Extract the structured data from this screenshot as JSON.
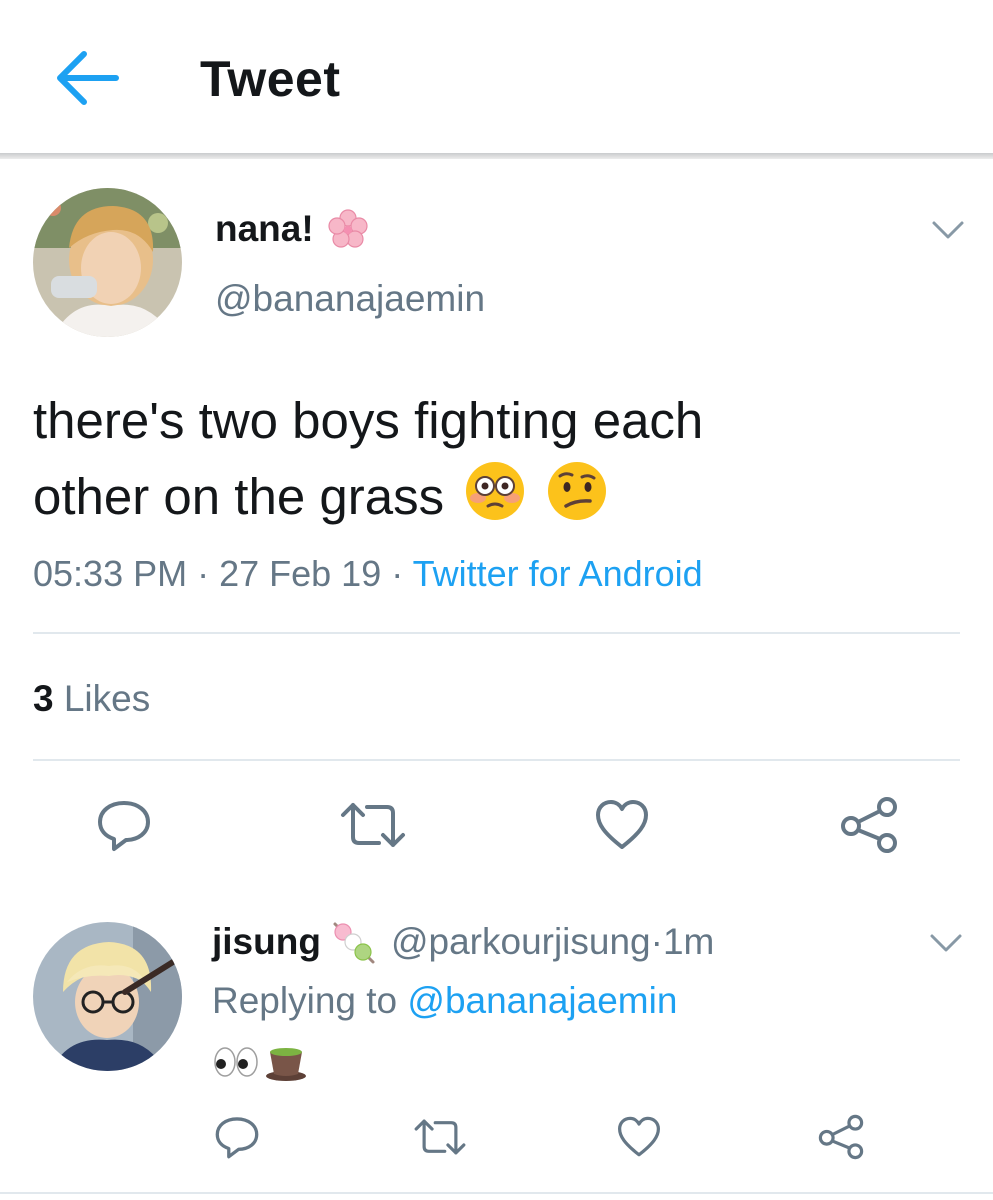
{
  "header": {
    "title": "Tweet"
  },
  "tweet": {
    "author_name": "nana!",
    "author_handle": "@bananajaemin",
    "text_line1": "there's two boys fighting each",
    "text_line2": "other on the grass",
    "time": "05:33 PM",
    "sep1": " · ",
    "date": "27 Feb 19",
    "sep2": " · ",
    "source": "Twitter for Android",
    "likes_count": "3",
    "likes_label": "Likes"
  },
  "reply": {
    "author_name": "jisung",
    "author_handle": "@parkourjisung",
    "dot": " · ",
    "time": "1m",
    "replying_prefix": "Replying to ",
    "replying_to": "@bananajaemin"
  },
  "icons": {
    "back": "arrow-left-icon",
    "caret": "chevron-down-icon",
    "reply": "speech-bubble-icon",
    "retweet": "retweet-icon",
    "like": "heart-icon",
    "share": "share-icon"
  },
  "colors": {
    "accent": "#1da1f2",
    "text": "#14171a",
    "secondary": "#657786",
    "divider": "#e1e8ed",
    "icon_gray": "#657786"
  }
}
